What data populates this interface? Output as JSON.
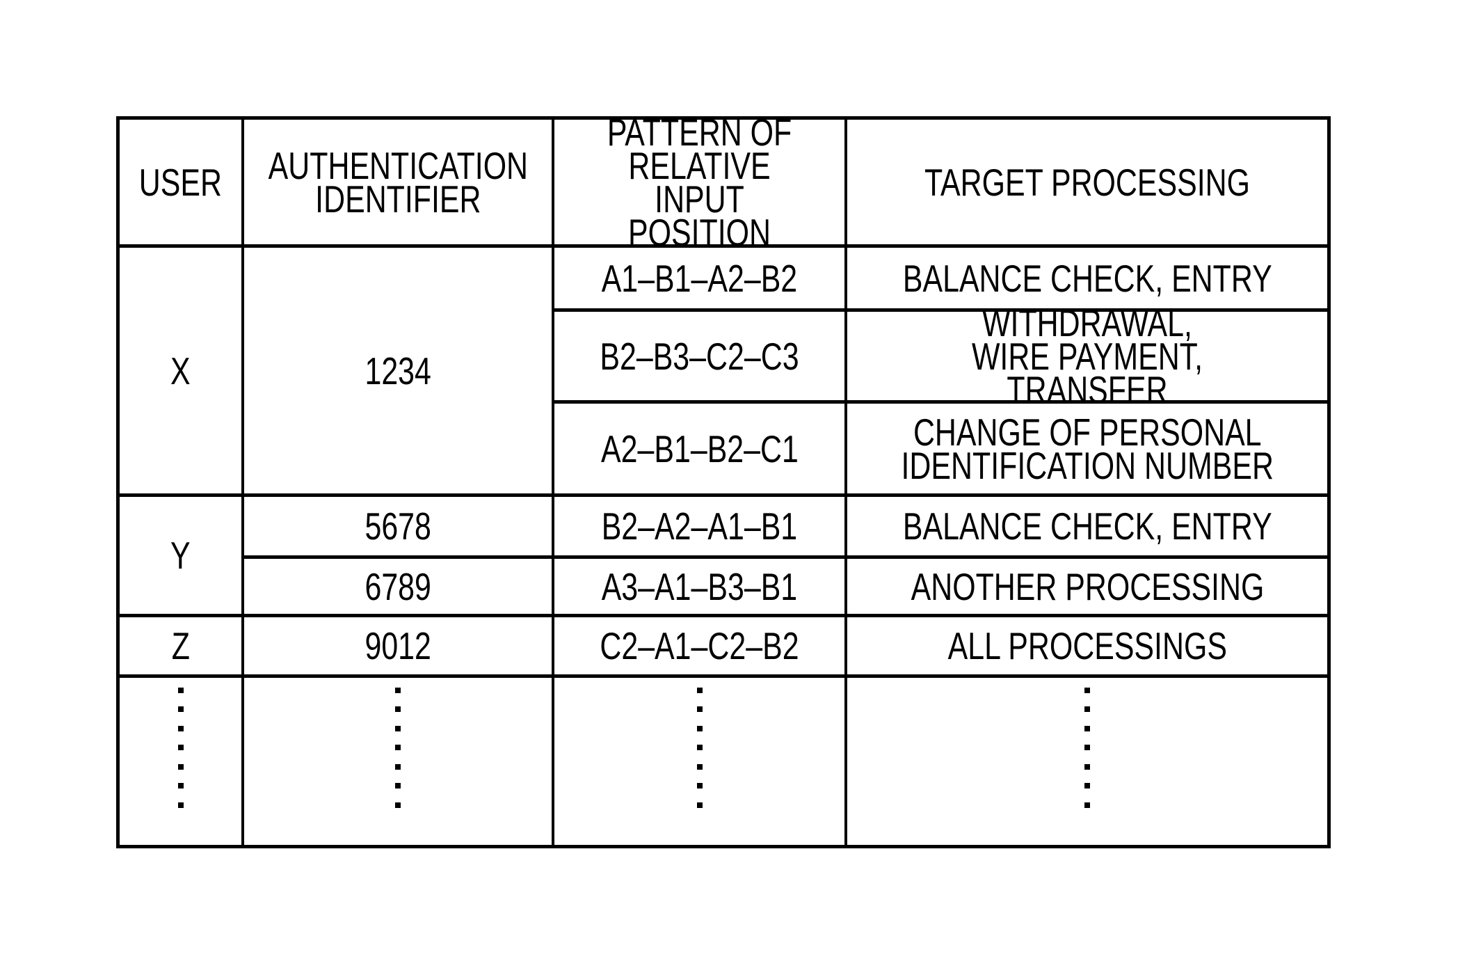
{
  "table": {
    "headers": {
      "user": "USER",
      "auth_id": "AUTHENTICATION\nIDENTIFIER",
      "pattern": "PATTERN OF\nRELATIVE INPUT\nPOSITION",
      "target": "TARGET PROCESSING"
    },
    "users": [
      {
        "user": "X",
        "auth_ids": [
          {
            "id": "1234",
            "patterns": [
              {
                "pattern": "A1–B1–A2–B2",
                "target": "BALANCE CHECK, ENTRY"
              },
              {
                "pattern": "B2–B3–C2–C3",
                "target": "WITHDRAWAL,\nWIRE PAYMENT, TRANSFER"
              },
              {
                "pattern": "A2–B1–B2–C1",
                "target": "CHANGE OF PERSONAL\nIDENTIFICATION NUMBER"
              }
            ]
          }
        ]
      },
      {
        "user": "Y",
        "auth_ids": [
          {
            "id": "5678",
            "patterns": [
              {
                "pattern": "B2–A2–A1–B1",
                "target": "BALANCE CHECK, ENTRY"
              }
            ]
          },
          {
            "id": "6789",
            "patterns": [
              {
                "pattern": "A3–A1–B3–B1",
                "target": "ANOTHER PROCESSING"
              }
            ]
          }
        ]
      },
      {
        "user": "Z",
        "auth_ids": [
          {
            "id": "9012",
            "patterns": [
              {
                "pattern": "C2–A1–C2–B2",
                "target": "ALL PROCESSINGS"
              }
            ]
          }
        ]
      }
    ],
    "continuation": {
      "glyph": "vertical-ellipsis",
      "dot_count": 7
    }
  }
}
